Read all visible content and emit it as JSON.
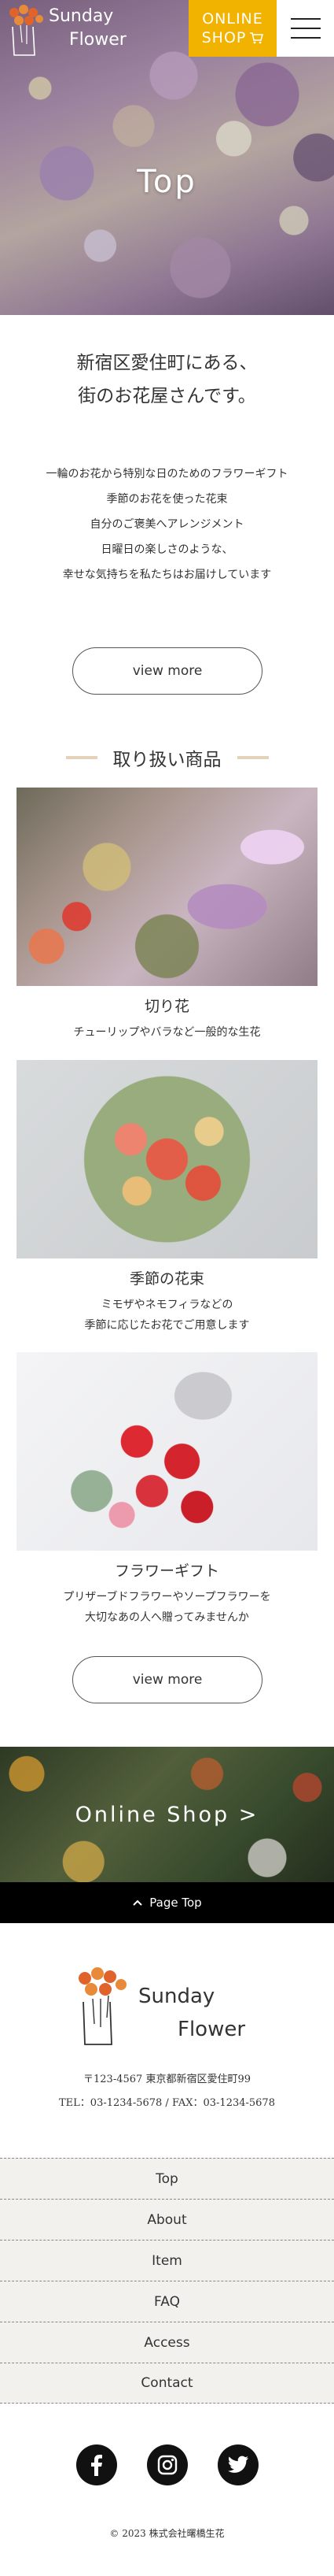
{
  "header": {
    "logo_line1": "Sunday",
    "logo_line2": "Flower",
    "online_line1": "ONLINE",
    "online_line2": "SHOP",
    "accent_color": "#f1b200"
  },
  "hero": {
    "title": "Top"
  },
  "intro": {
    "heading_line1": "新宿区愛住町にある、",
    "heading_line2": "街のお花屋さんです。",
    "lines": [
      "一輪のお花から特別な日のためのフラワーギフト",
      "季節のお花を使った花束",
      "自分のご褒美へアレンジメント",
      "日曜日の楽しさのような、",
      "幸せな気持ちを私たちはお届けしています"
    ],
    "view_more": "view more"
  },
  "products": {
    "title": "取り扱い商品",
    "items": [
      {
        "name": "切り花",
        "desc1": "チューリップやバラなど一般的な生花",
        "desc2": ""
      },
      {
        "name": "季節の花束",
        "desc1": "ミモザやネモフィラなどの",
        "desc2": "季節に応じたお花でご用意します"
      },
      {
        "name": "フラワーギフト",
        "desc1": "プリザーブドフラワーやソープフラワーを",
        "desc2": "大切なあの人へ贈ってみませんか"
      }
    ],
    "view_more": "view more"
  },
  "shop_banner": {
    "label": "Online Shop >"
  },
  "page_top": {
    "label": "Page Top"
  },
  "footer": {
    "logo_line1": "Sunday",
    "logo_line2": "Flower",
    "address": "〒123-4567 東京都新宿区愛住町99",
    "tel": "TEL：03-1234-5678 / FAX：03-1234-5678",
    "nav": [
      "Top",
      "About",
      "Item",
      "FAQ",
      "Access",
      "Contact"
    ],
    "social": [
      "facebook-icon",
      "instagram-icon",
      "twitter-icon"
    ],
    "copyright": "© 2023 株式会社曙橋生花"
  }
}
